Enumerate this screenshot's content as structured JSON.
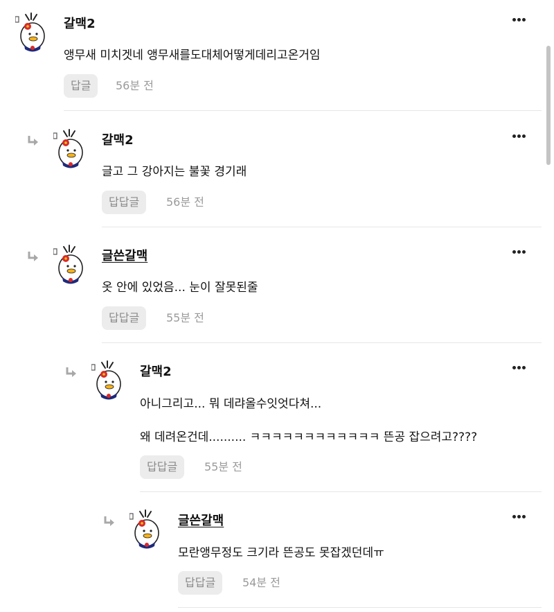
{
  "comments": [
    {
      "author": "갈맥2",
      "lines": [
        "앵무새 미치겟네 앵무새를도대체어떻게데리고온거임"
      ],
      "reply_label": "답글",
      "time": "56분 전"
    },
    {
      "author": "갈맥2",
      "lines": [
        "글고 그 강아지는 불꽃 경기래"
      ],
      "reply_label": "답답글",
      "time": "56분 전"
    },
    {
      "author": "글쓴갈맥",
      "lines": [
        "옷 안에 있었음... 눈이 잘못된줄"
      ],
      "reply_label": "답답글",
      "time": "55분 전"
    },
    {
      "author": "갈맥2",
      "lines": [
        "아니그리고... 뭐 데랴올수잇엇다쳐...",
        "왜 데려온건데.......... ㅋㅋㅋㅋㅋㅋㅋㅋㅋㅋㅋㅋ 뜬공 잡으려고????"
      ],
      "reply_label": "답답글",
      "time": "55분 전"
    },
    {
      "author": "글쓴갈맥",
      "lines": [
        "모란앵무정도 크기라 뜬공도 못잡겠던데ㅠ"
      ],
      "reply_label": "답답글",
      "time": "54분 전"
    }
  ],
  "icons": {
    "reply_arrow": "reply-arrow-icon",
    "more": "more-options-icon",
    "avatar": "mascot-avatar",
    "badge": "user-badge-icon"
  },
  "colors": {
    "text": "#111111",
    "muted": "#9a9a9a",
    "button_bg": "#ececec",
    "divider": "#e6e6e6"
  }
}
